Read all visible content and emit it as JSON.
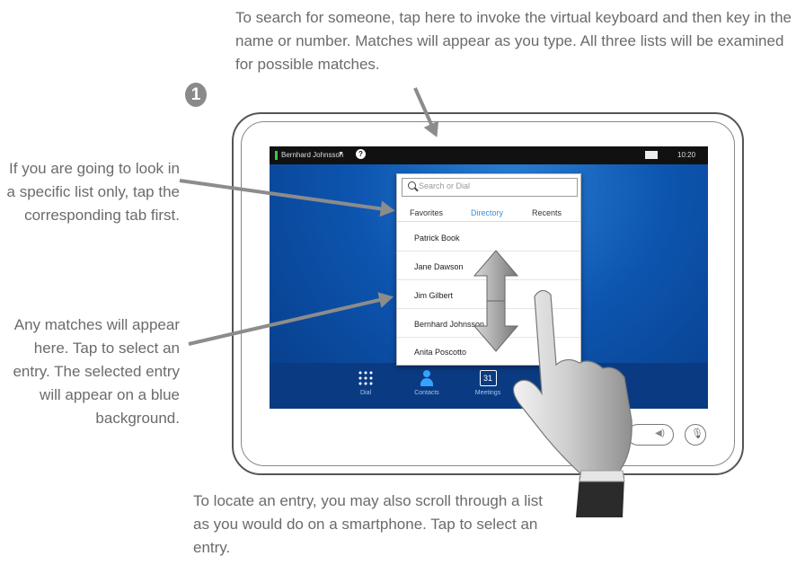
{
  "annotations": {
    "top": "To search for someone, tap here to invoke the virtual keyboard and then key in the name or number. Matches will appear as you type. All three lists will be examined for possible matches.",
    "left_tabs": "If you are going to look in a specific list only, tap the corresponding tab first.",
    "left_matches": "Any matches will appear here. Tap to select an entry. The selected entry will appear on a blue background.",
    "bottom": "To locate an entry, you may also scroll through a list as you would do on a smartphone. Tap to select an entry.",
    "step_number": "1"
  },
  "statusbar": {
    "user": "Bernhard Johnsson",
    "caret": "▼",
    "help": "?",
    "time": "10:20"
  },
  "search": {
    "placeholder": "Search or Dial"
  },
  "tabs": [
    {
      "label": "Favorites",
      "active": false
    },
    {
      "label": "Directory",
      "active": true
    },
    {
      "label": "Recents",
      "active": false
    }
  ],
  "entries": [
    "Patrick Book",
    "Jane Dawson",
    "Jim Gilbert",
    "Bernhard Johnsson",
    "Anita Poscotto"
  ],
  "bottombar": {
    "dial": "Dial",
    "contacts": "Contacts",
    "meetings": "Meetings",
    "meetings_date": "31"
  },
  "controls": {
    "volume_symbol": "◀)",
    "mute_symbol": "🎙"
  },
  "colors": {
    "accent": "#3a8fd8",
    "screen_blue": "#0c4fa8",
    "text_gray": "#6b6b6b"
  }
}
